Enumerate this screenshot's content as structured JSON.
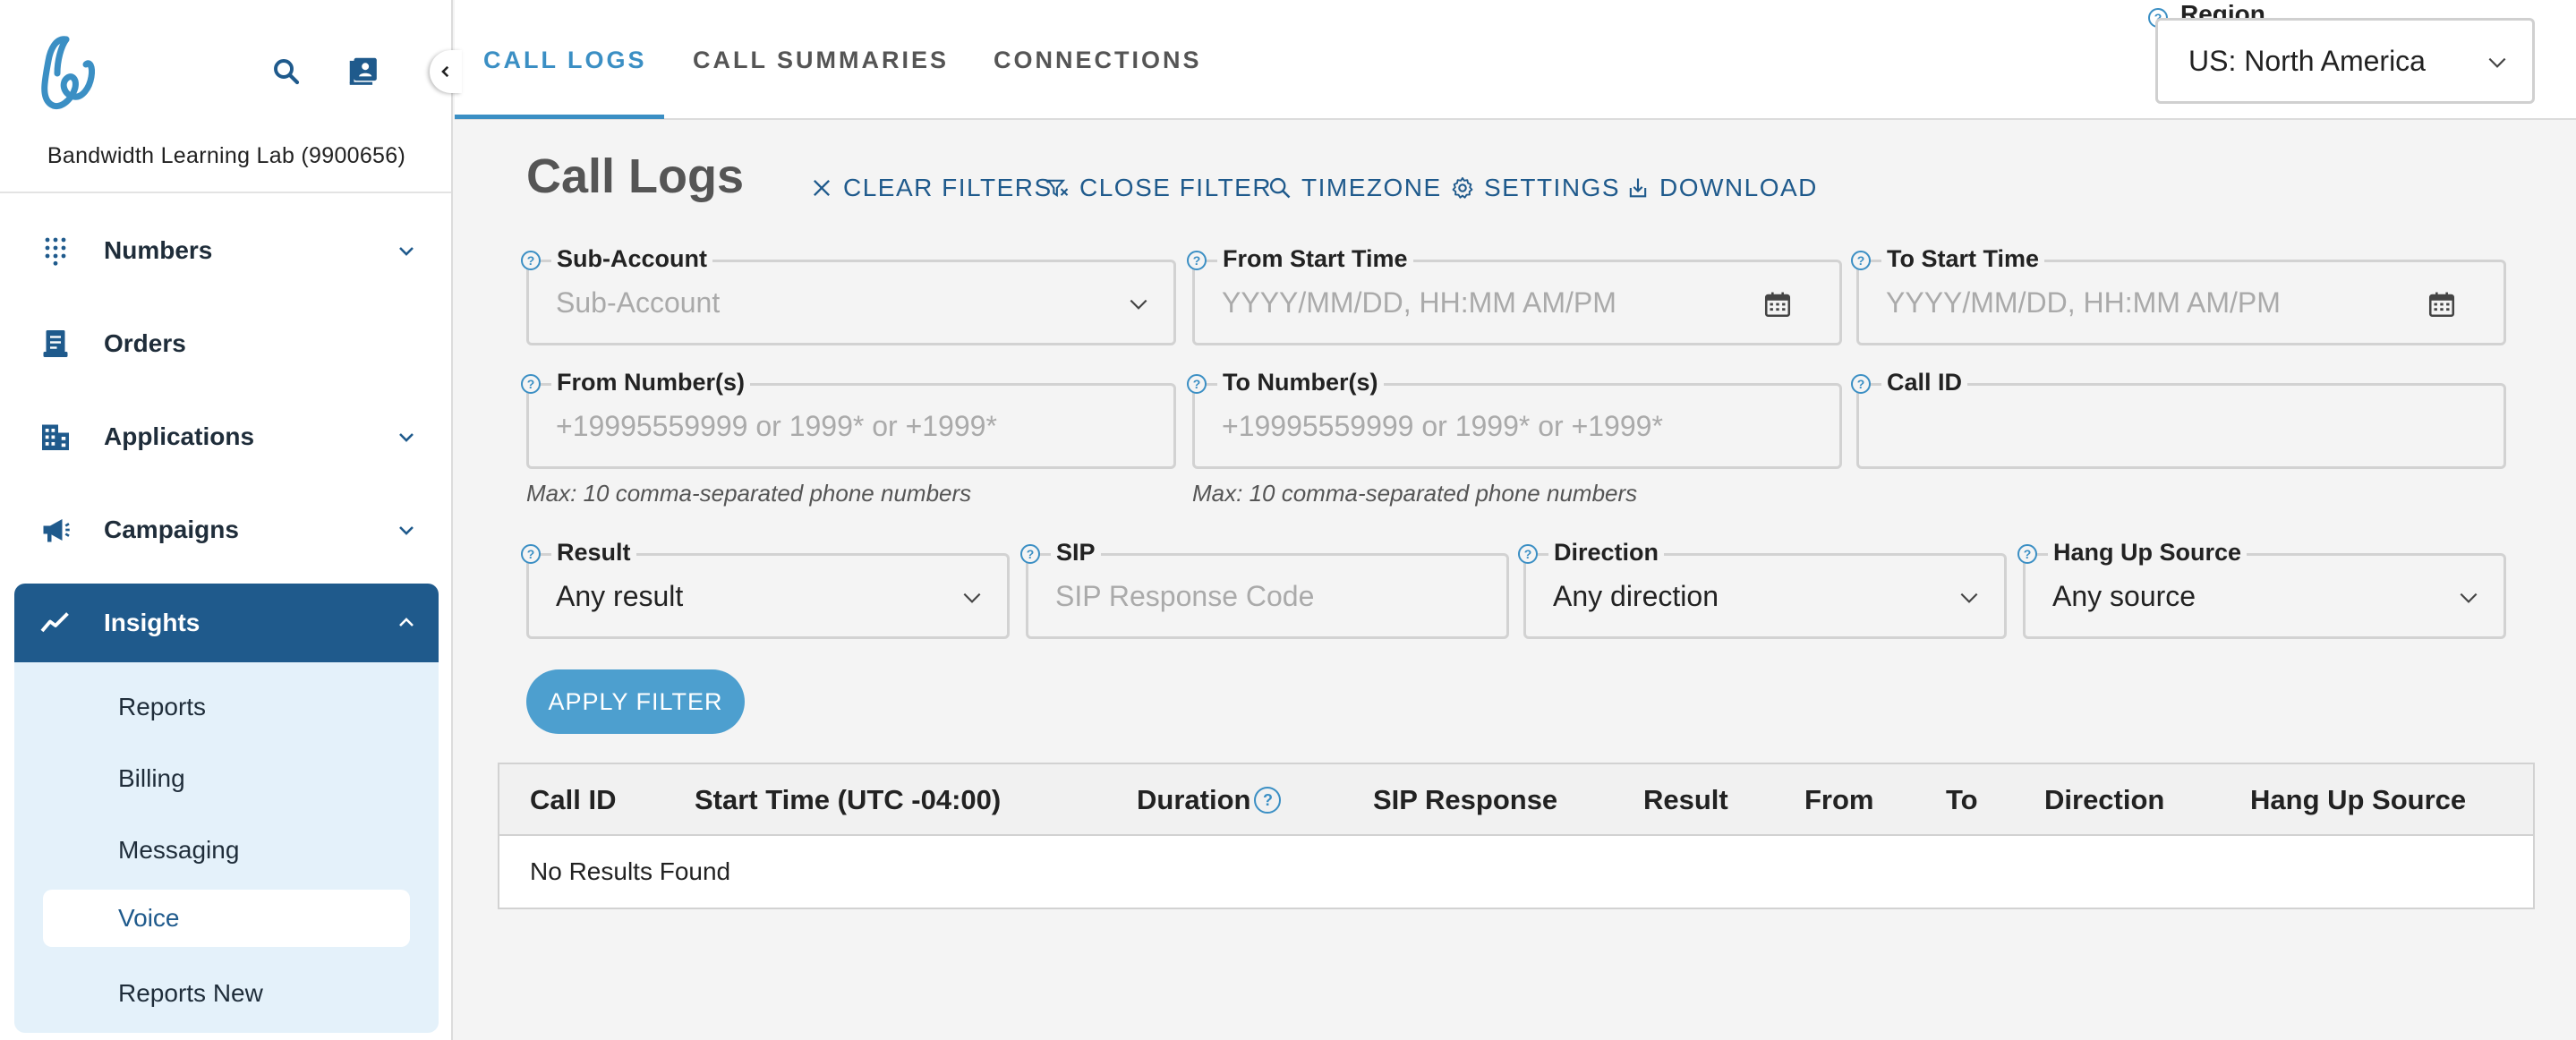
{
  "sidebar": {
    "account_name": "Bandwidth Learning Lab (9900656)",
    "items": [
      {
        "label": "Numbers",
        "icon": "dialpad-icon",
        "expandable": true
      },
      {
        "label": "Orders",
        "icon": "receipt-icon",
        "expandable": false
      },
      {
        "label": "Applications",
        "icon": "building-icon",
        "expandable": true
      },
      {
        "label": "Campaigns",
        "icon": "megaphone-icon",
        "expandable": true
      },
      {
        "label": "Insights",
        "icon": "trending-icon",
        "expandable": true,
        "expanded": true
      }
    ],
    "insights_sub": [
      {
        "label": "Reports"
      },
      {
        "label": "Billing"
      },
      {
        "label": "Messaging"
      },
      {
        "label": "Voice",
        "active": true
      },
      {
        "label": "Reports New"
      }
    ]
  },
  "tabs": [
    {
      "label": "CALL LOGS",
      "active": true
    },
    {
      "label": "CALL SUMMARIES"
    },
    {
      "label": "CONNECTIONS"
    }
  ],
  "region": {
    "label": "Region",
    "value": "US: North America"
  },
  "page": {
    "title": "Call Logs",
    "actions": {
      "clear_filters": "CLEAR FILTERS",
      "close_filter": "CLOSE FILTER",
      "timezone": "TIMEZONE",
      "settings": "SETTINGS",
      "download": "DOWNLOAD"
    }
  },
  "filters": {
    "sub_account": {
      "label": "Sub-Account",
      "placeholder": "Sub-Account"
    },
    "from_start_time": {
      "label": "From Start Time",
      "placeholder": "YYYY/MM/DD, HH:MM AM/PM"
    },
    "to_start_time": {
      "label": "To Start Time",
      "placeholder": "YYYY/MM/DD, HH:MM AM/PM"
    },
    "from_numbers": {
      "label": "From Number(s)",
      "placeholder": "+19995559999 or 1999* or +1999*",
      "hint": "Max: 10 comma-separated phone numbers"
    },
    "to_numbers": {
      "label": "To Number(s)",
      "placeholder": "+19995559999 or 1999* or +1999*",
      "hint": "Max: 10 comma-separated phone numbers"
    },
    "call_id": {
      "label": "Call ID",
      "placeholder": ""
    },
    "result": {
      "label": "Result",
      "value": "Any result"
    },
    "sip": {
      "label": "SIP",
      "placeholder": "SIP Response Code"
    },
    "direction": {
      "label": "Direction",
      "value": "Any direction"
    },
    "hang_up_source": {
      "label": "Hang Up Source",
      "value": "Any source"
    },
    "apply_label": "APPLY FILTER"
  },
  "table": {
    "columns": [
      "Call ID",
      "Start Time (UTC -04:00)",
      "Duration",
      "SIP Response",
      "Result",
      "From",
      "To",
      "Direction",
      "Hang Up Source"
    ],
    "empty_text": "No Results Found"
  },
  "colors": {
    "accent": "#3b8fc4",
    "nav_active": "#1f5a8c",
    "sub_panel": "#e4f1fa",
    "apply_button": "#4d9fcf"
  }
}
